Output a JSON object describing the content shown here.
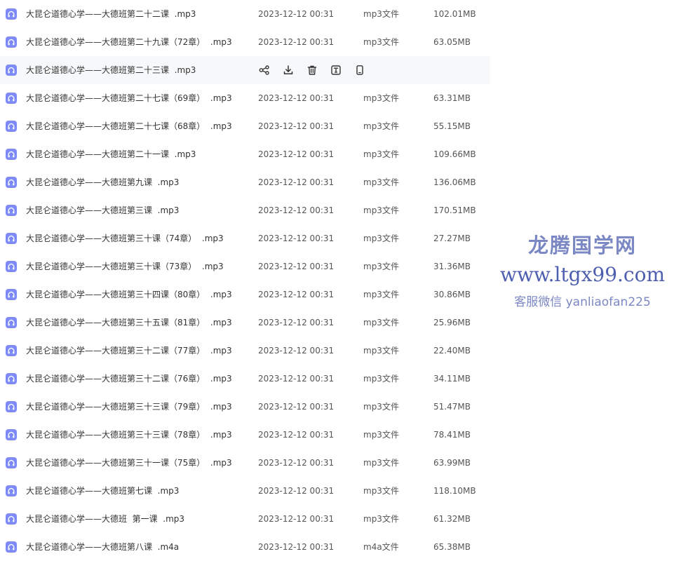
{
  "files": [
    {
      "name": "大昆仑道德心学——大德班第二十二课  .mp3",
      "date": "2023-12-12 00:31",
      "type": "mp3文件",
      "size": "102.01MB"
    },
    {
      "name": "大昆仑道德心学——大德班第二十九课（72章）  .mp3",
      "date": "2023-12-12 00:31",
      "type": "mp3文件",
      "size": "63.05MB"
    },
    {
      "name": "大昆仑道德心学——大德班第二十三课  .mp3",
      "date": "",
      "type": "",
      "size": "",
      "hovered": true
    },
    {
      "name": "大昆仑道德心学——大德班第二十七课（69章）  .mp3",
      "date": "2023-12-12 00:31",
      "type": "mp3文件",
      "size": "63.31MB"
    },
    {
      "name": "大昆仑道德心学——大德班第二十七课（68章）  .mp3",
      "date": "2023-12-12 00:31",
      "type": "mp3文件",
      "size": "55.15MB"
    },
    {
      "name": "大昆仑道德心学——大德班第二十一课  .mp3",
      "date": "2023-12-12 00:31",
      "type": "mp3文件",
      "size": "109.66MB"
    },
    {
      "name": "大昆仑道德心学——大德班第九课  .mp3",
      "date": "2023-12-12 00:31",
      "type": "mp3文件",
      "size": "136.06MB"
    },
    {
      "name": "大昆仑道德心学——大德班第三课  .mp3",
      "date": "2023-12-12 00:31",
      "type": "mp3文件",
      "size": "170.51MB"
    },
    {
      "name": "大昆仑道德心学——大德班第三十课（74章）  .mp3",
      "date": "2023-12-12 00:31",
      "type": "mp3文件",
      "size": "27.27MB"
    },
    {
      "name": "大昆仑道德心学——大德班第三十课（73章）  .mp3",
      "date": "2023-12-12 00:31",
      "type": "mp3文件",
      "size": "31.36MB"
    },
    {
      "name": "大昆仑道德心学——大德班第三十四课（80章）  .mp3",
      "date": "2023-12-12 00:31",
      "type": "mp3文件",
      "size": "30.86MB"
    },
    {
      "name": "大昆仑道德心学——大德班第三十五课（81章）  .mp3",
      "date": "2023-12-12 00:31",
      "type": "mp3文件",
      "size": "25.96MB"
    },
    {
      "name": "大昆仑道德心学——大德班第三十二课（77章）  .mp3",
      "date": "2023-12-12 00:31",
      "type": "mp3文件",
      "size": "22.40MB"
    },
    {
      "name": "大昆仑道德心学——大德班第三十二课（76章）  .mp3",
      "date": "2023-12-12 00:31",
      "type": "mp3文件",
      "size": "34.11MB"
    },
    {
      "name": "大昆仑道德心学——大德班第三十三课（79章）  .mp3",
      "date": "2023-12-12 00:31",
      "type": "mp3文件",
      "size": "51.47MB"
    },
    {
      "name": "大昆仑道德心学——大德班第三十三课（78章）  .mp3",
      "date": "2023-12-12 00:31",
      "type": "mp3文件",
      "size": "78.41MB"
    },
    {
      "name": "大昆仑道德心学——大德班第三十一课（75章）  .mp3",
      "date": "2023-12-12 00:31",
      "type": "mp3文件",
      "size": "63.99MB"
    },
    {
      "name": "大昆仑道德心学——大德班第七课  .mp3",
      "date": "2023-12-12 00:31",
      "type": "mp3文件",
      "size": "118.10MB"
    },
    {
      "name": "大昆仑道德心学——大德班  第一课  .mp3",
      "date": "2023-12-12 00:31",
      "type": "mp3文件",
      "size": "61.32MB"
    },
    {
      "name": "大昆仑道德心学——大德班第八课  .m4a",
      "date": "2023-12-12 00:31",
      "type": "m4a文件",
      "size": "65.38MB"
    }
  ],
  "row_actions": [
    {
      "icon": "share-icon"
    },
    {
      "icon": "download-icon"
    },
    {
      "icon": "trash-icon"
    },
    {
      "icon": "rename-icon"
    },
    {
      "icon": "phone-icon"
    }
  ],
  "watermark": {
    "line1": "龙腾国学网",
    "line2": "www.ltgx99.com",
    "line3": "客服微信 yanliaofan225"
  },
  "colors": {
    "file_icon": "#7e8af5",
    "hover_row": "#f7f8fa",
    "watermark_light": "#7b88c4",
    "watermark_dark": "#4e5fb0"
  }
}
